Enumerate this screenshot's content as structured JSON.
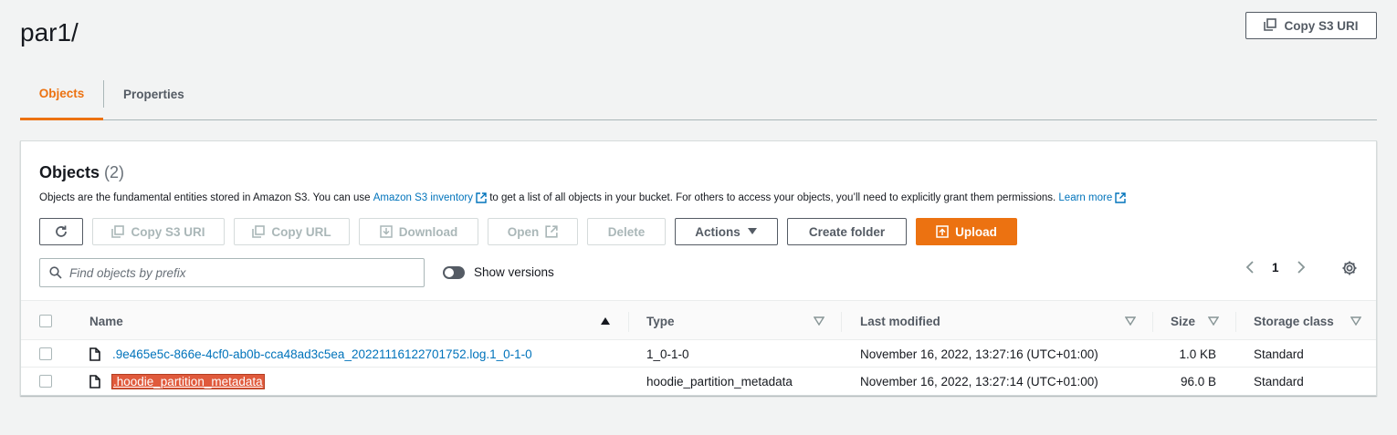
{
  "page": {
    "title": "par1/",
    "copy_s3_uri_label": "Copy S3 URI"
  },
  "tabs": [
    {
      "label": "Objects",
      "active": true
    },
    {
      "label": "Properties",
      "active": false
    }
  ],
  "panel": {
    "title": "Objects",
    "count": "(2)",
    "description_part1": "Objects are the fundamental entities stored in Amazon S3. You can use ",
    "inventory_link": "Amazon S3 inventory",
    "description_part2": " to get a list of all objects in your bucket. For others to access your objects, you’ll need to explicitly grant them permissions. ",
    "learn_more_link": "Learn more"
  },
  "toolbar": {
    "copy_s3_uri": "Copy S3 URI",
    "copy_url": "Copy URL",
    "download": "Download",
    "open": "Open",
    "delete": "Delete",
    "actions": "Actions",
    "create_folder": "Create folder",
    "upload": "Upload"
  },
  "search": {
    "placeholder": "Find objects by prefix",
    "value": ""
  },
  "show_versions": {
    "label": "Show versions",
    "enabled": false
  },
  "pagination": {
    "current_page": "1"
  },
  "table": {
    "columns": [
      "Name",
      "Type",
      "Last modified",
      "Size",
      "Storage class"
    ],
    "rows": [
      {
        "name": ".9e465e5c-866e-4cf0-ab0b-cca48ad3c5ea_20221116122701752.log.1_0-1-0",
        "type": "1_0-1-0",
        "last_modified": "November 16, 2022, 13:27:16 (UTC+01:00)",
        "size": "1.0 KB",
        "storage_class": "Standard"
      },
      {
        "name": ".hoodie_partition_metadata",
        "type": "hoodie_partition_metadata",
        "last_modified": "November 16, 2022, 13:27:14 (UTC+01:00)",
        "size": "96.0 B",
        "storage_class": "Standard"
      }
    ]
  },
  "colors": {
    "accent": "#ec7211",
    "link": "#0073bb",
    "highlight": "#e05a3c"
  }
}
